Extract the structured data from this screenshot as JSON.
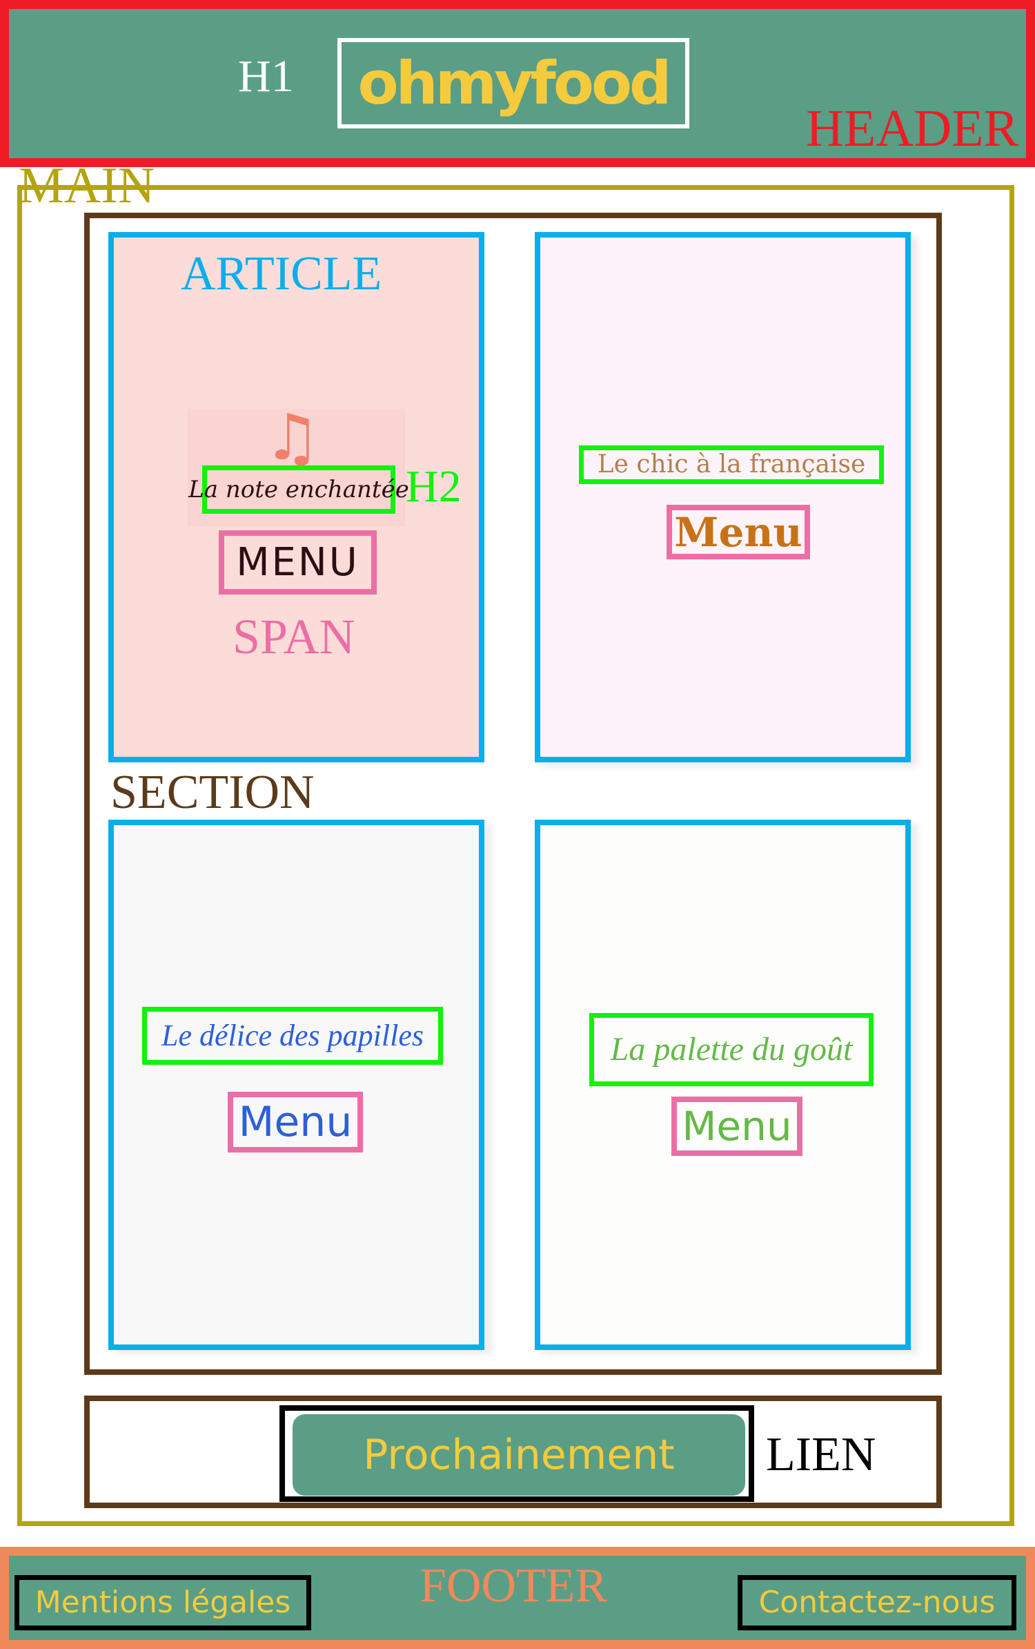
{
  "labels": {
    "h1": "H1",
    "header": "HEADER",
    "main": "MAIN",
    "article": "ARTICLE",
    "h2": "H2",
    "span": "SPAN",
    "section": "SECTION",
    "lien": "LIEN",
    "footer": "FOOTER"
  },
  "header": {
    "logo": "ohmyfood"
  },
  "articles": [
    {
      "title": "La note enchantée",
      "menu": "MENU",
      "icon": "music-note-icon"
    },
    {
      "title": "Le chic à la française",
      "menu": "Menu"
    },
    {
      "title": "Le délice des papilles",
      "menu": "Menu"
    },
    {
      "title": "La palette du goût",
      "menu": "Menu"
    }
  ],
  "cta": {
    "label": "Prochainement"
  },
  "footer": {
    "links": [
      "Mentions légales",
      "Contactez-nous"
    ]
  },
  "colors": {
    "header_border": "#ee1c25",
    "brand_green": "#5a9e86",
    "brand_yellow": "#f5cb3d",
    "main_border": "#b3a410",
    "section_border": "#5c3a1a",
    "article_border": "#09aeed",
    "h2_border": "#12f20e",
    "span_border": "#ec6ea5",
    "footer_border": "#f2895a"
  }
}
